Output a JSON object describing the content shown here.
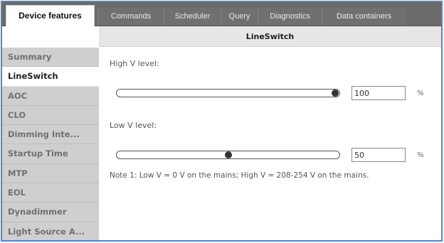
{
  "tabs": [
    {
      "label": "Device features"
    },
    {
      "label": "Commands"
    },
    {
      "label": "Scheduler"
    },
    {
      "label": "Query"
    },
    {
      "label": "Diagnostics"
    },
    {
      "label": "Data containers"
    }
  ],
  "header": {
    "title": "LineSwitch"
  },
  "sidebar": {
    "items": [
      {
        "label": "Summary"
      },
      {
        "label": "LineSwitch"
      },
      {
        "label": "AOC"
      },
      {
        "label": "CLO"
      },
      {
        "label": "Dimming Inte..."
      },
      {
        "label": "Startup Time"
      },
      {
        "label": "MTP"
      },
      {
        "label": "EOL"
      },
      {
        "label": "Dynadimmer"
      },
      {
        "label": "Light Source A..."
      }
    ]
  },
  "main": {
    "high": {
      "label": "High V level:",
      "value": "100",
      "level_percent": 100,
      "unit": "%"
    },
    "low": {
      "label": "Low V level:",
      "value": "50",
      "level_percent": 50,
      "unit": "%"
    },
    "note": "Note 1: Low V = 0 V on the mains; High V = 208-254 V on the mains."
  }
}
